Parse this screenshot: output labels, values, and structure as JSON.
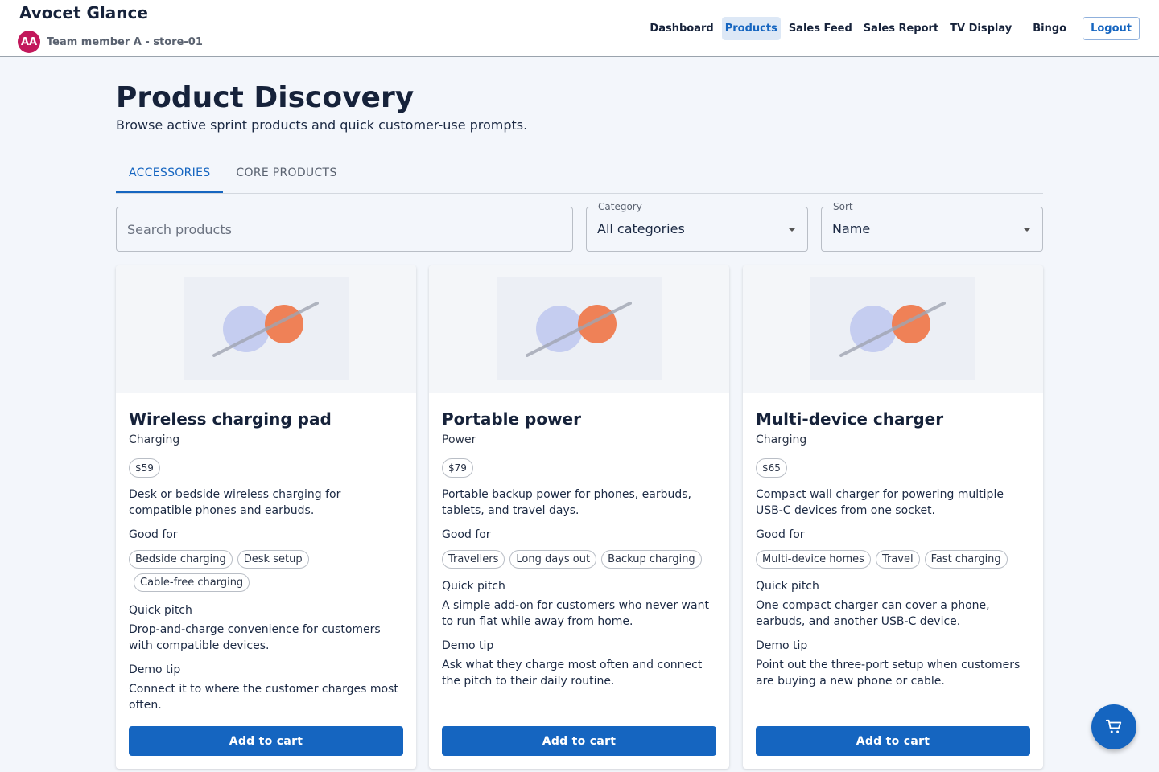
{
  "header": {
    "brand": "Avocet Glance",
    "avatar_initials": "AA",
    "user_label": "Team member A - store-01",
    "nav": [
      "Dashboard",
      "Products",
      "Sales Feed",
      "Sales Report",
      "TV Display",
      "Bingo"
    ],
    "active_nav": "Products",
    "logout": "Logout"
  },
  "page": {
    "title": "Product Discovery",
    "subtitle": "Browse active sprint products and quick customer-use prompts."
  },
  "tabs": [
    "ACCESSORIES",
    "CORE PRODUCTS"
  ],
  "active_tab": "ACCESSORIES",
  "filters": {
    "search_placeholder": "Search products",
    "category_label": "Category",
    "category_value": "All categories",
    "sort_label": "Sort",
    "sort_value": "Name"
  },
  "labels": {
    "good_for": "Good for",
    "quick_pitch": "Quick pitch",
    "demo_tip": "Demo tip",
    "add_to_cart": "Add to cart"
  },
  "products": [
    {
      "name": "Wireless charging pad",
      "category": "Charging",
      "price": "$59",
      "description": "Desk or bedside wireless charging for compatible phones and earbuds.",
      "good_for": [
        "Bedside charging",
        "Desk setup",
        "Cable-free charging"
      ],
      "quick_pitch": "Drop-and-charge convenience for customers with compatible devices.",
      "demo_tip": "Connect it to where the customer charges most often."
    },
    {
      "name": "Portable power",
      "category": "Power",
      "price": "$79",
      "description": "Portable backup power for phones, earbuds, tablets, and travel days.",
      "good_for": [
        "Travellers",
        "Long days out",
        "Backup charging"
      ],
      "quick_pitch": "A simple add-on for customers who never want to run flat while away from home.",
      "demo_tip": "Ask what they charge most often and connect the pitch to their daily routine."
    },
    {
      "name": "Multi-device charger",
      "category": "Charging",
      "price": "$65",
      "description": "Compact wall charger for powering multiple USB-C devices from one socket.",
      "good_for": [
        "Multi-device homes",
        "Travel",
        "Fast charging"
      ],
      "quick_pitch": "One compact charger can cover a phone, earbuds, and another USB-C device.",
      "demo_tip": "Point out the three-port setup when customers are buying a new phone or cable."
    }
  ],
  "icons": {
    "cart": "cart-icon",
    "product_image": "product-placeholder-image"
  },
  "colors": {
    "primary": "#1565c0",
    "avatar": "#c2185b",
    "image_circle_left": "#c5cdf0",
    "image_circle_right": "#ef8157"
  }
}
